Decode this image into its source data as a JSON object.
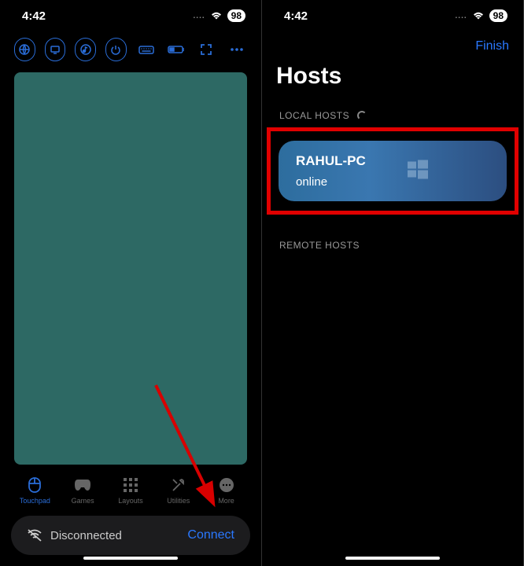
{
  "status": {
    "time": "4:42",
    "battery": "98"
  },
  "left": {
    "tabs": {
      "touchpad": "Touchpad",
      "games": "Games",
      "layouts": "Layouts",
      "utilities": "Utilities",
      "more": "More"
    },
    "connection": {
      "status": "Disconnected",
      "action": "Connect"
    }
  },
  "right": {
    "nav_finish": "Finish",
    "title": "Hosts",
    "sections": {
      "local": "LOCAL HOSTS",
      "remote": "REMOTE HOSTS"
    },
    "host": {
      "name": "RAHUL-PC",
      "status": "online"
    }
  }
}
